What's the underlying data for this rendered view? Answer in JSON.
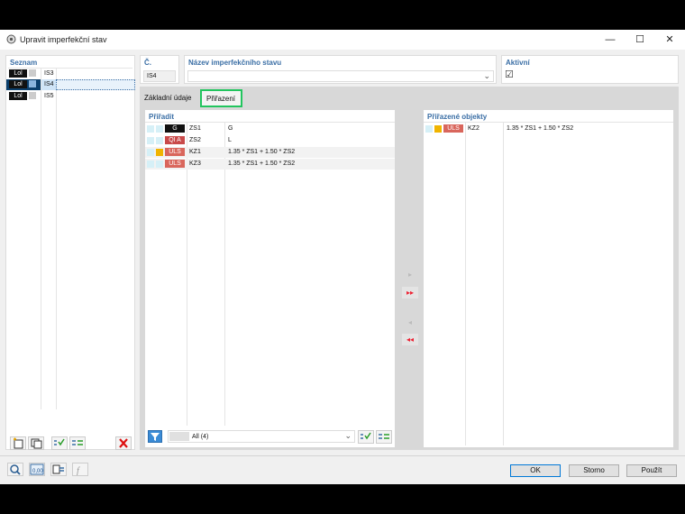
{
  "window": {
    "title": "Upravit imperfekční stav",
    "minimize": "—",
    "maximize": "☐",
    "close": "✕"
  },
  "seznam": {
    "header": "Seznam",
    "items": [
      {
        "badge": "Lol",
        "label": "IS3"
      },
      {
        "badge": "Lol",
        "label": "IS4"
      },
      {
        "badge": "Lol",
        "label": "IS5"
      }
    ]
  },
  "number": {
    "header": "Č.",
    "value": "IS4"
  },
  "name": {
    "header": "Název imperfekčního stavu",
    "value": ""
  },
  "active": {
    "header": "Aktivní",
    "checked": "☑"
  },
  "tabs": [
    {
      "label": "Základní údaje"
    },
    {
      "label": "Přiřazení"
    }
  ],
  "assign": {
    "header": "Přiřadit",
    "rows": [
      {
        "badge": "G",
        "id": "ZS1",
        "desc": "G"
      },
      {
        "badge": "QI A",
        "id": "ZS2",
        "desc": "L"
      },
      {
        "badge": "ULS",
        "id": "KZ1",
        "desc": "1.35 * ZS1 + 1.50 * ZS2"
      },
      {
        "badge": "ULS",
        "id": "KZ3",
        "desc": "1.35 * ZS1 + 1.50 * ZS2"
      }
    ],
    "filter_value": "All (4)"
  },
  "assigned": {
    "header": "Přiřazené objekty",
    "rows": [
      {
        "badge": "ULS",
        "id": "KZ2",
        "desc": "1.35 * ZS1 + 1.50 * ZS2"
      }
    ]
  },
  "buttons": {
    "ok": "OK",
    "cancel": "Storno",
    "apply": "Použít"
  },
  "colors": {
    "accent": "#3a6ea5",
    "uls": "#d9665c",
    "qi": "#c94a4a",
    "highlight": "#22c55e",
    "yellow": "#f0b400"
  }
}
